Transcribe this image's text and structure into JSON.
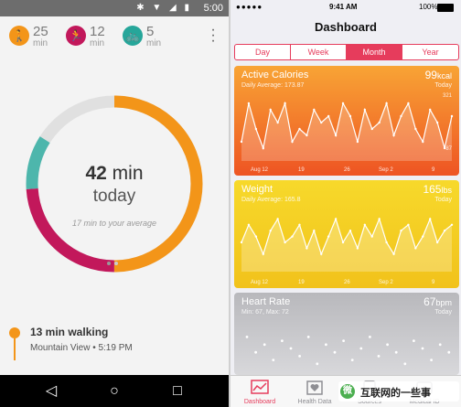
{
  "android": {
    "status": {
      "time": "5:00",
      "icons": "✱ ▼ ◢ ▮"
    },
    "stats": [
      {
        "value": "25",
        "unit": "min",
        "color": "#f39519",
        "icon": "walk-icon",
        "glyph": "🚶"
      },
      {
        "value": "12",
        "unit": "min",
        "color": "#c2185b",
        "icon": "run-icon",
        "glyph": "🏃"
      },
      {
        "value": "5",
        "unit": "min",
        "color": "#26a69a",
        "icon": "bike-icon",
        "glyph": "🚲"
      }
    ],
    "ring": {
      "minutes": "42",
      "unit": "min",
      "sub": "today",
      "note": "17 min to your average",
      "segments": [
        {
          "name": "walking",
          "fraction": 0.5,
          "color": "#f39519"
        },
        {
          "name": "running",
          "fraction": 0.24,
          "color": "#c2185b"
        },
        {
          "name": "cycling",
          "fraction": 0.1,
          "color": "#4db6ac"
        }
      ]
    },
    "activity": {
      "title": "13 min walking",
      "location": "Mountain View • 5:19 PM"
    },
    "nav": {
      "back": "◁",
      "home": "○",
      "recent": "□"
    }
  },
  "ios": {
    "status": {
      "carrier": "●●●●● ",
      "time": "9:41 AM",
      "battery": "100%"
    },
    "title": "Dashboard",
    "segments": [
      "Day",
      "Week",
      "Month",
      "Year"
    ],
    "active_segment": "Month",
    "cards": [
      {
        "title": "Active Calories",
        "subtitle": "Daily Average: 173.87",
        "value": "99",
        "unit": "kcal",
        "date": "Today",
        "ymax": "321",
        "ymin": "87",
        "xlabels": [
          "Aug 12",
          "19",
          "26",
          "Sep 2",
          "9"
        ]
      },
      {
        "title": "Weight",
        "subtitle": "Daily Average: 165.8",
        "value": "165",
        "unit": "lbs",
        "date": "Today",
        "ymax": "",
        "ymin": "",
        "xlabels": [
          "Aug 12",
          "19",
          "26",
          "Sep 2",
          "9"
        ]
      },
      {
        "title": "Heart Rate",
        "subtitle": "Min: 67, Max: 72",
        "value": "67",
        "unit": "bpm",
        "date": "Today"
      }
    ],
    "tabs": [
      {
        "label": "Dashboard",
        "icon": "dashboard-icon",
        "active": true
      },
      {
        "label": "Health Data",
        "icon": "health-data-icon",
        "active": false
      },
      {
        "label": "Sources",
        "icon": "sources-icon",
        "active": false
      },
      {
        "label": "Medical ID",
        "icon": "medical-id-icon",
        "active": false
      }
    ]
  },
  "watermark": {
    "text": "互联网的一些事",
    "logo": "微"
  },
  "colors": {
    "orange": "#f39519",
    "magenta": "#c2185b",
    "teal": "#4db6ac",
    "ios_red": "#e63c5c"
  }
}
